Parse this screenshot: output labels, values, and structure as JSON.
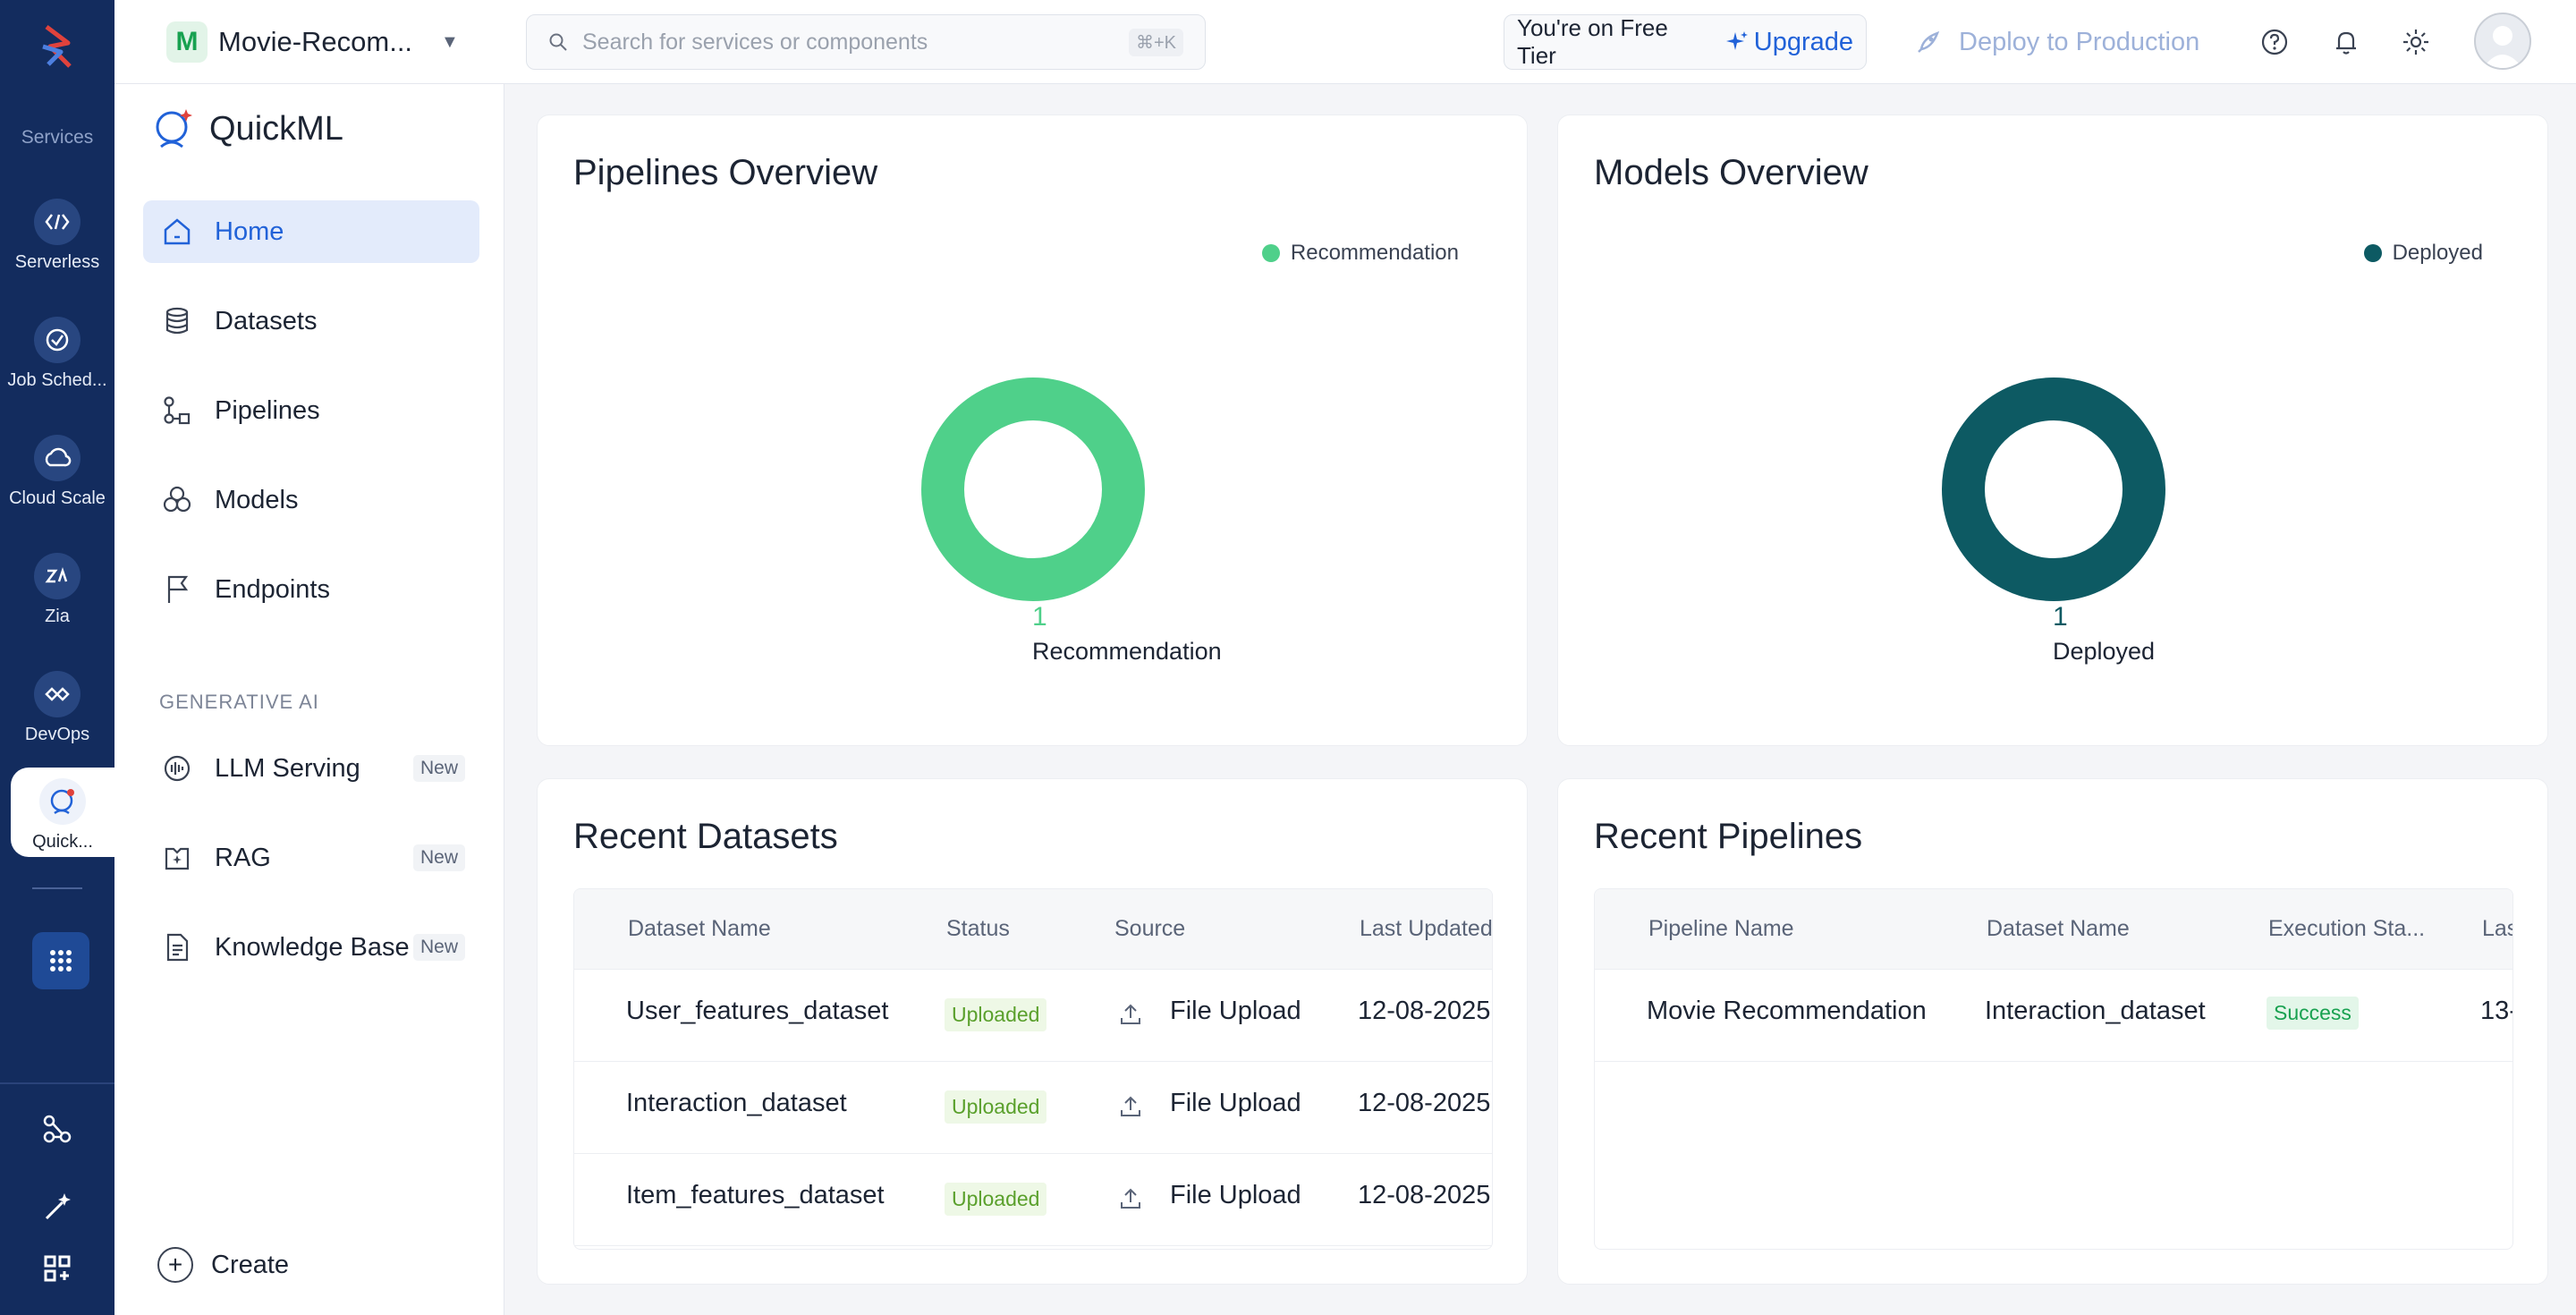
{
  "rail": {
    "services_title": "Services",
    "items": [
      {
        "label": "Serverless",
        "icon": "serverless-icon"
      },
      {
        "label": "Job Sched...",
        "icon": "job-scheduler-icon"
      },
      {
        "label": "Cloud Scale",
        "icon": "cloud-scale-icon"
      },
      {
        "label": "Zia",
        "icon": "zia-icon"
      },
      {
        "label": "DevOps",
        "icon": "devops-icon"
      },
      {
        "label": "Quick...",
        "icon": "quickml-icon"
      }
    ]
  },
  "topbar": {
    "project_initial": "M",
    "project_name": "Movie-Recom...",
    "search_placeholder": "Search for services or components",
    "search_shortcut": "⌘+K",
    "tier_text": "You're on Free Tier",
    "upgrade_label": "Upgrade",
    "deploy_label": "Deploy to Production"
  },
  "sidenav": {
    "brand": "QuickML",
    "items": [
      {
        "label": "Home"
      },
      {
        "label": "Datasets"
      },
      {
        "label": "Pipelines"
      },
      {
        "label": "Models"
      },
      {
        "label": "Endpoints"
      }
    ],
    "section_title": "GENERATIVE AI",
    "gen_items": [
      {
        "label": "LLM Serving",
        "badge": "New"
      },
      {
        "label": "RAG",
        "badge": "New"
      },
      {
        "label": "Knowledge Base",
        "badge": "New"
      }
    ],
    "create_label": "Create"
  },
  "pipelines_overview": {
    "title": "Pipelines Overview",
    "legend": "Recommendation",
    "count": "1",
    "label": "Recommendation",
    "color": "#4fd08a"
  },
  "models_overview": {
    "title": "Models Overview",
    "legend": "Deployed",
    "count": "1",
    "label": "Deployed",
    "color": "#0d5a63"
  },
  "recent_datasets": {
    "title": "Recent Datasets",
    "columns": [
      "Dataset Name",
      "Status",
      "Source",
      "Last Updated"
    ],
    "rows": [
      {
        "name": "User_features_dataset",
        "status": "Uploaded",
        "source": "File Upload",
        "updated": "12-08-2025"
      },
      {
        "name": "Interaction_dataset",
        "status": "Uploaded",
        "source": "File Upload",
        "updated": "12-08-2025"
      },
      {
        "name": "Item_features_dataset",
        "status": "Uploaded",
        "source": "File Upload",
        "updated": "12-08-2025"
      }
    ]
  },
  "recent_pipelines": {
    "title": "Recent Pipelines",
    "columns": [
      "Pipeline Name",
      "Dataset Name",
      "Execution Sta...",
      "Las"
    ],
    "rows": [
      {
        "name": "Movie Recommendation",
        "dataset": "Interaction_dataset",
        "status": "Success",
        "last": "13-"
      }
    ]
  }
}
